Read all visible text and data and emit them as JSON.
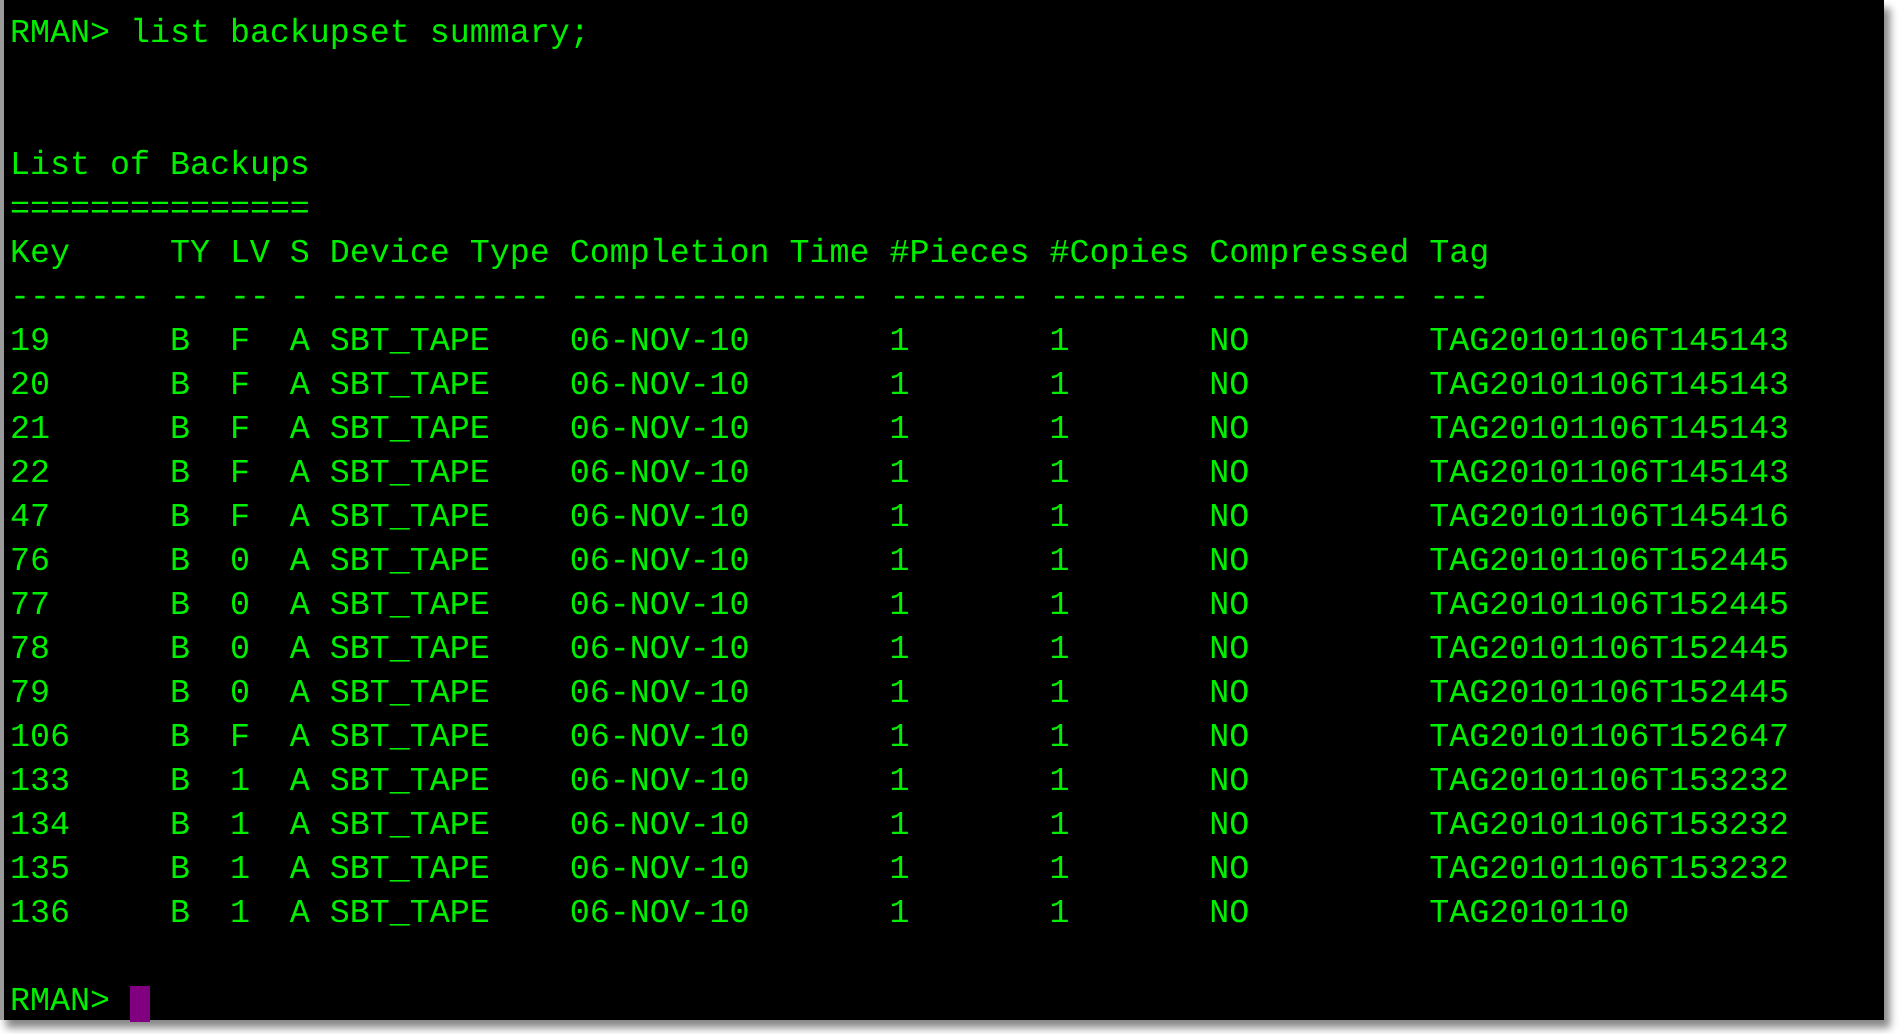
{
  "command_line": {
    "prompt": "RMAN>",
    "command": "list backupset summary;"
  },
  "title": "List of Backups",
  "title_rule": "===============",
  "columns": [
    {
      "label": "Key",
      "rule": "-------"
    },
    {
      "label": "TY",
      "rule": "--"
    },
    {
      "label": "LV",
      "rule": "--"
    },
    {
      "label": "S",
      "rule": "-"
    },
    {
      "label": "Device Type",
      "rule": "-----------"
    },
    {
      "label": "Completion Time",
      "rule": "---------------"
    },
    {
      "label": "#Pieces",
      "rule": "-------"
    },
    {
      "label": "#Copies",
      "rule": "-------"
    },
    {
      "label": "Compressed",
      "rule": "----------"
    },
    {
      "label": "Tag",
      "rule": "---"
    }
  ],
  "rows": [
    [
      "19",
      "B",
      "F",
      "A",
      "SBT_TAPE",
      "06-NOV-10",
      "1",
      "1",
      "NO",
      "TAG20101106T145143"
    ],
    [
      "20",
      "B",
      "F",
      "A",
      "SBT_TAPE",
      "06-NOV-10",
      "1",
      "1",
      "NO",
      "TAG20101106T145143"
    ],
    [
      "21",
      "B",
      "F",
      "A",
      "SBT_TAPE",
      "06-NOV-10",
      "1",
      "1",
      "NO",
      "TAG20101106T145143"
    ],
    [
      "22",
      "B",
      "F",
      "A",
      "SBT_TAPE",
      "06-NOV-10",
      "1",
      "1",
      "NO",
      "TAG20101106T145143"
    ],
    [
      "47",
      "B",
      "F",
      "A",
      "SBT_TAPE",
      "06-NOV-10",
      "1",
      "1",
      "NO",
      "TAG20101106T145416"
    ],
    [
      "76",
      "B",
      "0",
      "A",
      "SBT_TAPE",
      "06-NOV-10",
      "1",
      "1",
      "NO",
      "TAG20101106T152445"
    ],
    [
      "77",
      "B",
      "0",
      "A",
      "SBT_TAPE",
      "06-NOV-10",
      "1",
      "1",
      "NO",
      "TAG20101106T152445"
    ],
    [
      "78",
      "B",
      "0",
      "A",
      "SBT_TAPE",
      "06-NOV-10",
      "1",
      "1",
      "NO",
      "TAG20101106T152445"
    ],
    [
      "79",
      "B",
      "0",
      "A",
      "SBT_TAPE",
      "06-NOV-10",
      "1",
      "1",
      "NO",
      "TAG20101106T152445"
    ],
    [
      "106",
      "B",
      "F",
      "A",
      "SBT_TAPE",
      "06-NOV-10",
      "1",
      "1",
      "NO",
      "TAG20101106T152647"
    ],
    [
      "133",
      "B",
      "1",
      "A",
      "SBT_TAPE",
      "06-NOV-10",
      "1",
      "1",
      "NO",
      "TAG20101106T153232"
    ],
    [
      "134",
      "B",
      "1",
      "A",
      "SBT_TAPE",
      "06-NOV-10",
      "1",
      "1",
      "NO",
      "TAG20101106T153232"
    ],
    [
      "135",
      "B",
      "1",
      "A",
      "SBT_TAPE",
      "06-NOV-10",
      "1",
      "1",
      "NO",
      "TAG20101106T153232"
    ],
    [
      "136",
      "B",
      "1",
      "A",
      "SBT_TAPE",
      "06-NOV-10",
      "1",
      "1",
      "NO",
      "TAG2010110"
    ]
  ],
  "prompt": "RMAN>"
}
